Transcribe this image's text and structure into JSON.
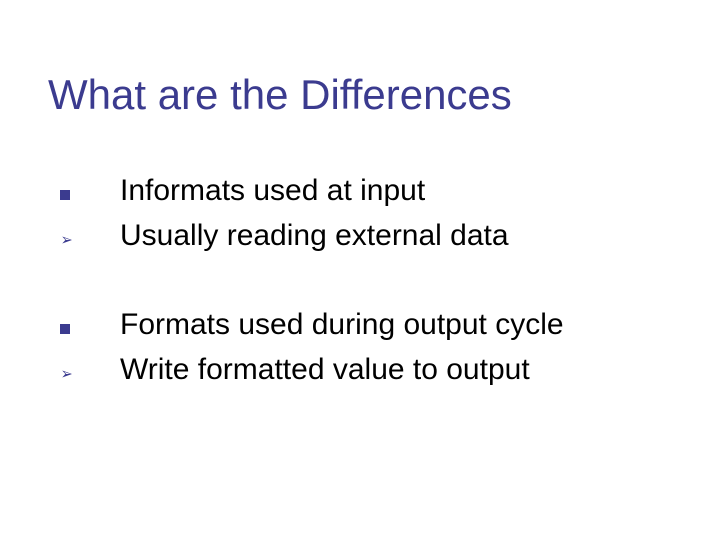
{
  "slide": {
    "title": "What are the Differences",
    "group1": {
      "item1": "Informats used at input",
      "sub1": "Usually reading external data"
    },
    "group2": {
      "item1": "Formats used during output cycle",
      "sub1": "Write formatted value to output"
    }
  }
}
